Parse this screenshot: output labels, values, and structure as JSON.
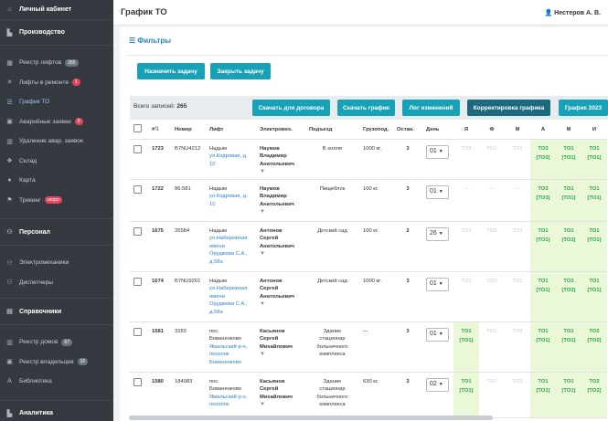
{
  "sidebar": {
    "account": "Личный кабинет",
    "production": "Производство",
    "items": [
      {
        "label": "Реестр лифтов",
        "badge": "265"
      },
      {
        "label": "Лифты в ремонте",
        "badge": "1"
      },
      {
        "label": "График ТО"
      },
      {
        "label": "Аварийные заявки",
        "badge": "0"
      },
      {
        "label": "Удаление авар. заявок"
      },
      {
        "label": "Склад"
      },
      {
        "label": "Карта"
      },
      {
        "label": "Трекинг",
        "badge": "скоро"
      }
    ],
    "personnel": "Персонал",
    "personnel_items": [
      {
        "label": "Электромеханики"
      },
      {
        "label": "Диспетчеры"
      }
    ],
    "references": "Справочники",
    "reference_items": [
      {
        "label": "Реестр домов",
        "badge": "67"
      },
      {
        "label": "Реестр владельцев",
        "badge": "10"
      },
      {
        "label": "Библиотека"
      }
    ],
    "analytics": "Аналитика"
  },
  "header": {
    "title": "График ТО",
    "user": "Нестеров А. В."
  },
  "filters": {
    "label": "Фильтры"
  },
  "actions": {
    "assign": "Назначить задачу",
    "close": "Закрыть задачу"
  },
  "toolbar": {
    "records_label": "Всего записей:",
    "records_count": "265",
    "download_contract": "Скачать для договора",
    "download_schedule": "Скачать график",
    "change_log": "Лог изменений",
    "correct": "Корректировка графика",
    "year": "График 2023"
  },
  "table": {
    "headers": [
      "#",
      "Номер",
      "Лифт",
      "Электромех.",
      "Подъезд",
      "Грузопод.",
      "Остан.",
      "День",
      "Я",
      "Ф",
      "М",
      "А",
      "М",
      "И"
    ],
    "rows": [
      {
        "id": "1723",
        "number": "B7NU4212",
        "lift": [
          "Надым"
        ],
        "lift_link": [
          "ул.Кодровая, д.",
          "10"
        ],
        "mech": [
          "Наумов",
          "Владимир",
          "Анатольевич"
        ],
        "entrance": [
          "В холле"
        ],
        "capacity": "1000 кг.",
        "stops": "3",
        "day": "01",
        "m": [
          [
            "ТО2",
            ""
          ],
          [
            "ТО1",
            ""
          ],
          [
            "ТО1",
            ""
          ],
          [
            "ТО3",
            "[ТО3]"
          ],
          [
            "ТО1",
            "[ТО1]"
          ],
          [
            "ТО1",
            "[ТО1]"
          ]
        ]
      },
      {
        "id": "1722",
        "number": "86.581",
        "lift": [
          "Надым"
        ],
        "lift_link": [
          "ул.Кодровая, д.",
          "10"
        ],
        "mech": [
          "Наумов",
          "Владимир",
          "Анатольевич"
        ],
        "entrance": [
          "Пищеблок"
        ],
        "capacity": "100 кг.",
        "stops": "3",
        "day": "01",
        "m": [
          [
            "—",
            ""
          ],
          [
            "—",
            ""
          ],
          [
            "—",
            ""
          ],
          [
            "ТО3",
            "[ТО3]"
          ],
          [
            "ТО1",
            "[ТО1]"
          ],
          [
            "ТО1",
            "[ТО1]"
          ]
        ]
      },
      {
        "id": "1675",
        "number": "26584",
        "lift": [
          "Надым"
        ],
        "lift_link": [
          "ул.Набережная",
          "имени",
          "Оруджева С.А.,",
          "д.58а"
        ],
        "mech": [
          "Антонов",
          "Сергей",
          "Анатольевич"
        ],
        "entrance": [
          "Детский сад"
        ],
        "capacity": "100 кг.",
        "stops": "2",
        "day": "26",
        "m": [
          [
            "ТО1",
            ""
          ],
          [
            "ТО2",
            ""
          ],
          [
            "ТО1",
            ""
          ],
          [
            "ТО1",
            "[ТО1]"
          ],
          [
            "ТО1",
            "[ТО3]"
          ],
          [
            "ТО1",
            "[ТО1]"
          ]
        ]
      },
      {
        "id": "1674",
        "number": "B7NU9261",
        "lift": [
          "Надым"
        ],
        "lift_link": [
          "ул.Набережная",
          "имени",
          "Оруджева С.А.,",
          "д.58а"
        ],
        "mech": [
          "Антонов",
          "Сергей",
          "Анатольевич"
        ],
        "entrance": [
          "Детский сад"
        ],
        "capacity": "1000 кг.",
        "stops": "3",
        "day": "01",
        "m": [
          [
            "ТО1",
            ""
          ],
          [
            "ТО2",
            ""
          ],
          [
            "ТО1",
            ""
          ],
          [
            "ТО1",
            "[ТО1]"
          ],
          [
            "ТО3",
            "[ТО3]"
          ],
          [
            "ТО1",
            "[ТО1]"
          ]
        ]
      },
      {
        "id": "1581",
        "number": "3283",
        "lift": [
          "пос.",
          "Бованенково"
        ],
        "lift_link": [
          "Ямальский р-н,",
          "поселок",
          "Бованенково"
        ],
        "mech": [
          "Касьянов",
          "Сергей",
          "Михайлович"
        ],
        "entrance": [
          "Здание",
          "стационар",
          "больничного",
          "комплекса"
        ],
        "capacity": "—",
        "stops": "3",
        "day": "01",
        "m": [
          [
            "ТО1",
            "[ТО1]"
          ],
          [
            "ТО1",
            ""
          ],
          [
            "ТО3",
            ""
          ],
          [
            "ТО1",
            "[ТО1]"
          ],
          [
            "ТО1",
            "[ТО1]"
          ],
          [
            "ТО2",
            "[ТО2]"
          ]
        ]
      },
      {
        "id": "1580",
        "number": "184983",
        "lift": [
          "пос.",
          "Бованенково"
        ],
        "lift_link": [
          "Ямальский р-н,",
          "поселок"
        ],
        "mech": [
          "Касьянов",
          "Сергей",
          "Михайлович"
        ],
        "entrance": [
          "Здание",
          "стационар",
          "больничного",
          "комплекса"
        ],
        "capacity": "630 кг.",
        "stops": "3",
        "day": "02",
        "m": [
          [
            "ТО1",
            "[ТО1]"
          ],
          [
            "ТО1",
            ""
          ],
          [
            "ТО3",
            ""
          ],
          [
            "ТО1",
            "[ТО1]"
          ],
          [
            "ТО1",
            "[ТО1]"
          ],
          [
            "ТО2",
            "[ТО2]"
          ]
        ]
      }
    ]
  }
}
